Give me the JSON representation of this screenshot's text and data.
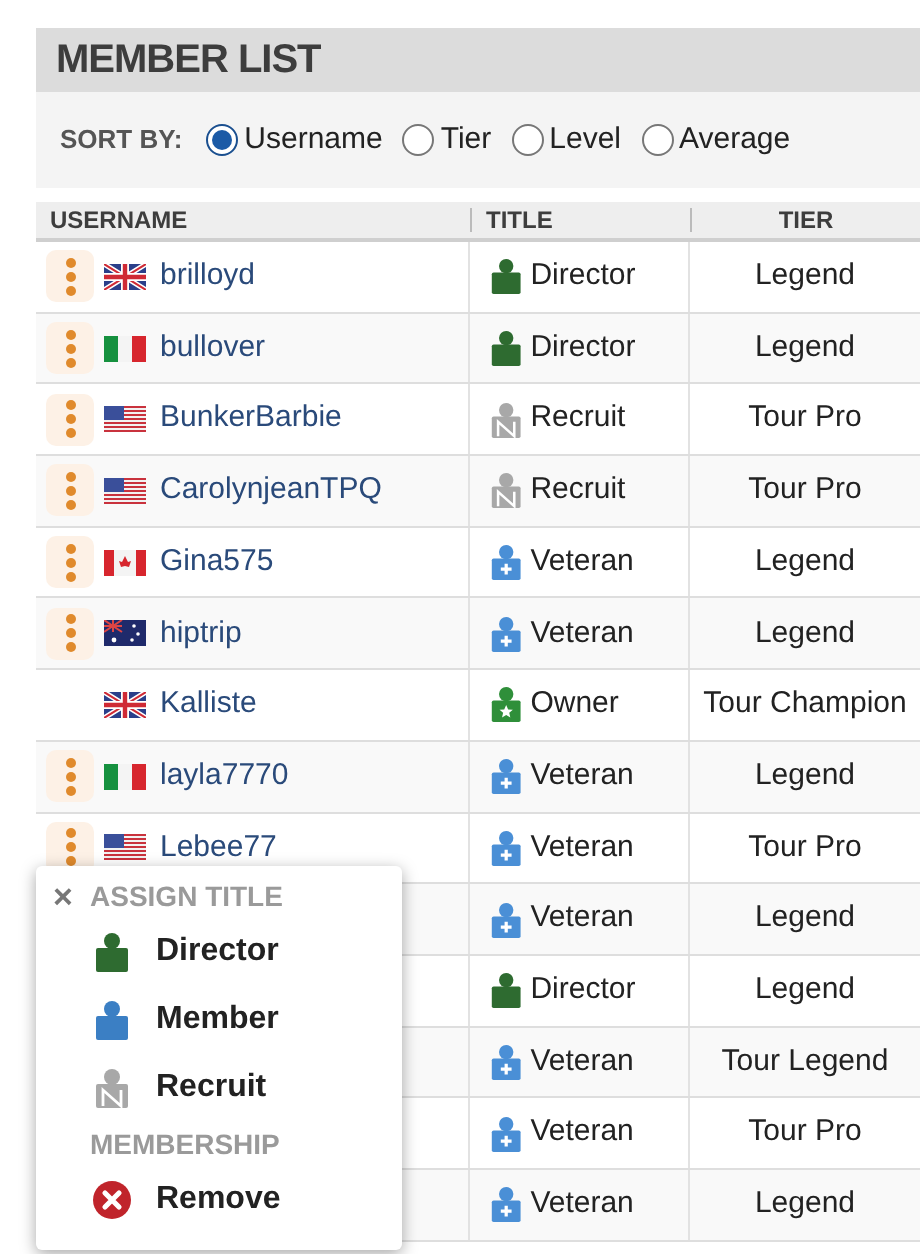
{
  "panel": {
    "title": "MEMBER LIST"
  },
  "sort": {
    "label": "SORT BY:",
    "options": [
      {
        "label": "Username",
        "selected": true
      },
      {
        "label": "Tier",
        "selected": false
      },
      {
        "label": "Level",
        "selected": false
      },
      {
        "label": "Average",
        "selected": false
      }
    ]
  },
  "table": {
    "columns": [
      "USERNAME",
      "TITLE",
      "TIER"
    ],
    "rows": [
      {
        "has_menu": true,
        "flag": {
          "kind": "uk"
        },
        "username": "brilloyd",
        "title": {
          "kind": "director",
          "label": "Director"
        },
        "tier": "Legend"
      },
      {
        "has_menu": true,
        "flag": {
          "kind": "it"
        },
        "username": "bullover",
        "title": {
          "kind": "director",
          "label": "Director"
        },
        "tier": "Legend"
      },
      {
        "has_menu": true,
        "flag": {
          "kind": "us"
        },
        "username": "BunkerBarbie",
        "title": {
          "kind": "recruit",
          "label": "Recruit"
        },
        "tier": "Tour Pro"
      },
      {
        "has_menu": true,
        "flag": {
          "kind": "us"
        },
        "username": "CarolynjeanTPQ",
        "title": {
          "kind": "recruit",
          "label": "Recruit"
        },
        "tier": "Tour Pro"
      },
      {
        "has_menu": true,
        "flag": {
          "kind": "ca"
        },
        "username": "Gina575",
        "title": {
          "kind": "veteran",
          "label": "Veteran"
        },
        "tier": "Legend"
      },
      {
        "has_menu": true,
        "flag": {
          "kind": "au"
        },
        "username": "hiptrip",
        "title": {
          "kind": "veteran",
          "label": "Veteran"
        },
        "tier": "Legend"
      },
      {
        "has_menu": false,
        "flag": {
          "kind": "uk"
        },
        "username": "Kalliste",
        "title": {
          "kind": "owner",
          "label": "Owner"
        },
        "tier": "Tour Champion"
      },
      {
        "has_menu": true,
        "flag": {
          "kind": "it"
        },
        "username": "layla7770",
        "title": {
          "kind": "veteran",
          "label": "Veteran"
        },
        "tier": "Legend"
      },
      {
        "has_menu": true,
        "flag": {
          "kind": "us"
        },
        "username": "Lebee77",
        "title": {
          "kind": "veteran",
          "label": "Veteran"
        },
        "tier": "Tour Pro"
      },
      {
        "title": {
          "kind": "veteran",
          "label": "Veteran"
        },
        "tier": "Legend"
      },
      {
        "title": {
          "kind": "director",
          "label": "Director"
        },
        "tier": "Legend"
      },
      {
        "title": {
          "kind": "veteran",
          "label": "Veteran"
        },
        "tier": "Tour Legend"
      },
      {
        "title": {
          "kind": "veteran",
          "label": "Veteran"
        },
        "tier": "Tour Pro"
      },
      {
        "title": {
          "kind": "veteran",
          "label": "Veteran"
        },
        "tier": "Legend"
      }
    ]
  },
  "popup": {
    "close": "×",
    "sections": [
      {
        "heading": "ASSIGN TITLE",
        "items": [
          {
            "kind": "director",
            "label": "Director"
          },
          {
            "kind": "member",
            "label": "Member"
          },
          {
            "kind": "recruit",
            "label": "Recruit"
          }
        ]
      },
      {
        "heading": "MEMBERSHIP",
        "items": [
          {
            "kind": "remove",
            "label": "Remove"
          }
        ]
      }
    ]
  }
}
